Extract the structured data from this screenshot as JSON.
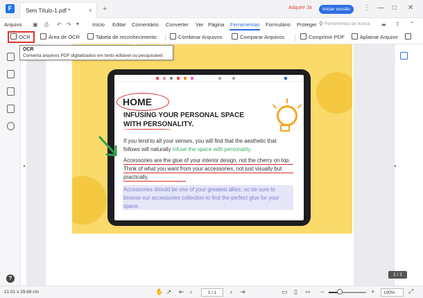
{
  "titlebar": {
    "tab_title": "Sem Título-1.pdf *",
    "tab_close": "×",
    "tab_add": "+",
    "buy_label": "Adquirir Já",
    "login_label": "Iniciar sessão",
    "win_minimize": "—",
    "win_maximize": "□",
    "win_close": "✕"
  },
  "menubar": {
    "file_label": "Arquivo",
    "items": [
      {
        "label": "Início"
      },
      {
        "label": "Editar"
      },
      {
        "label": "Comentário"
      },
      {
        "label": "Converter"
      },
      {
        "label": "Ver"
      },
      {
        "label": "Página"
      },
      {
        "label": "Ferramentas",
        "active": true
      },
      {
        "label": "Formulário"
      },
      {
        "label": "Proteger"
      }
    ],
    "search_tools": "Ferramentas de busca"
  },
  "toolbar": {
    "ocr": "OCR",
    "ocr_area": "Área de OCR",
    "recognition_table": "Tabela de reconhecimento",
    "combine": "Combinar Arquivos",
    "compare": "Comparar Arquivos",
    "compress": "Comprimir PDF",
    "flatten": "Aplainar Arquivo"
  },
  "tooltip": {
    "title": "OCR",
    "description": "Converta arquivos PDF digitalizados em texto editável ou pesquisável."
  },
  "document": {
    "home": "HOME",
    "headline": "INFUSING YOUR PERSONAL SPACE WITH PERSONALITY.",
    "para1_start": "If you tend to all your senses, you will find that the aesthetic that follows will naturally ",
    "para1_green": "infuse the space with personality.",
    "para2": "Accessories are the glue of your interior design, not the cherry on top. Think of what you want from your accessories, not just visually but practically.",
    "para3": "Accessories should be one of your greatest allies, so be sure to browse our accessories collection to find the perfect glue for your space."
  },
  "page_badge": "1 / 1",
  "statusbar": {
    "dimensions": "21.01 x 29.69 cm",
    "page_value": "1 / 1",
    "zoom_value": "100%",
    "zoom_fraction": 0.3
  },
  "colors": {
    "accent": "#2f6ee5",
    "highlight_red": "#e03030",
    "yellow": "#f9da6a"
  }
}
